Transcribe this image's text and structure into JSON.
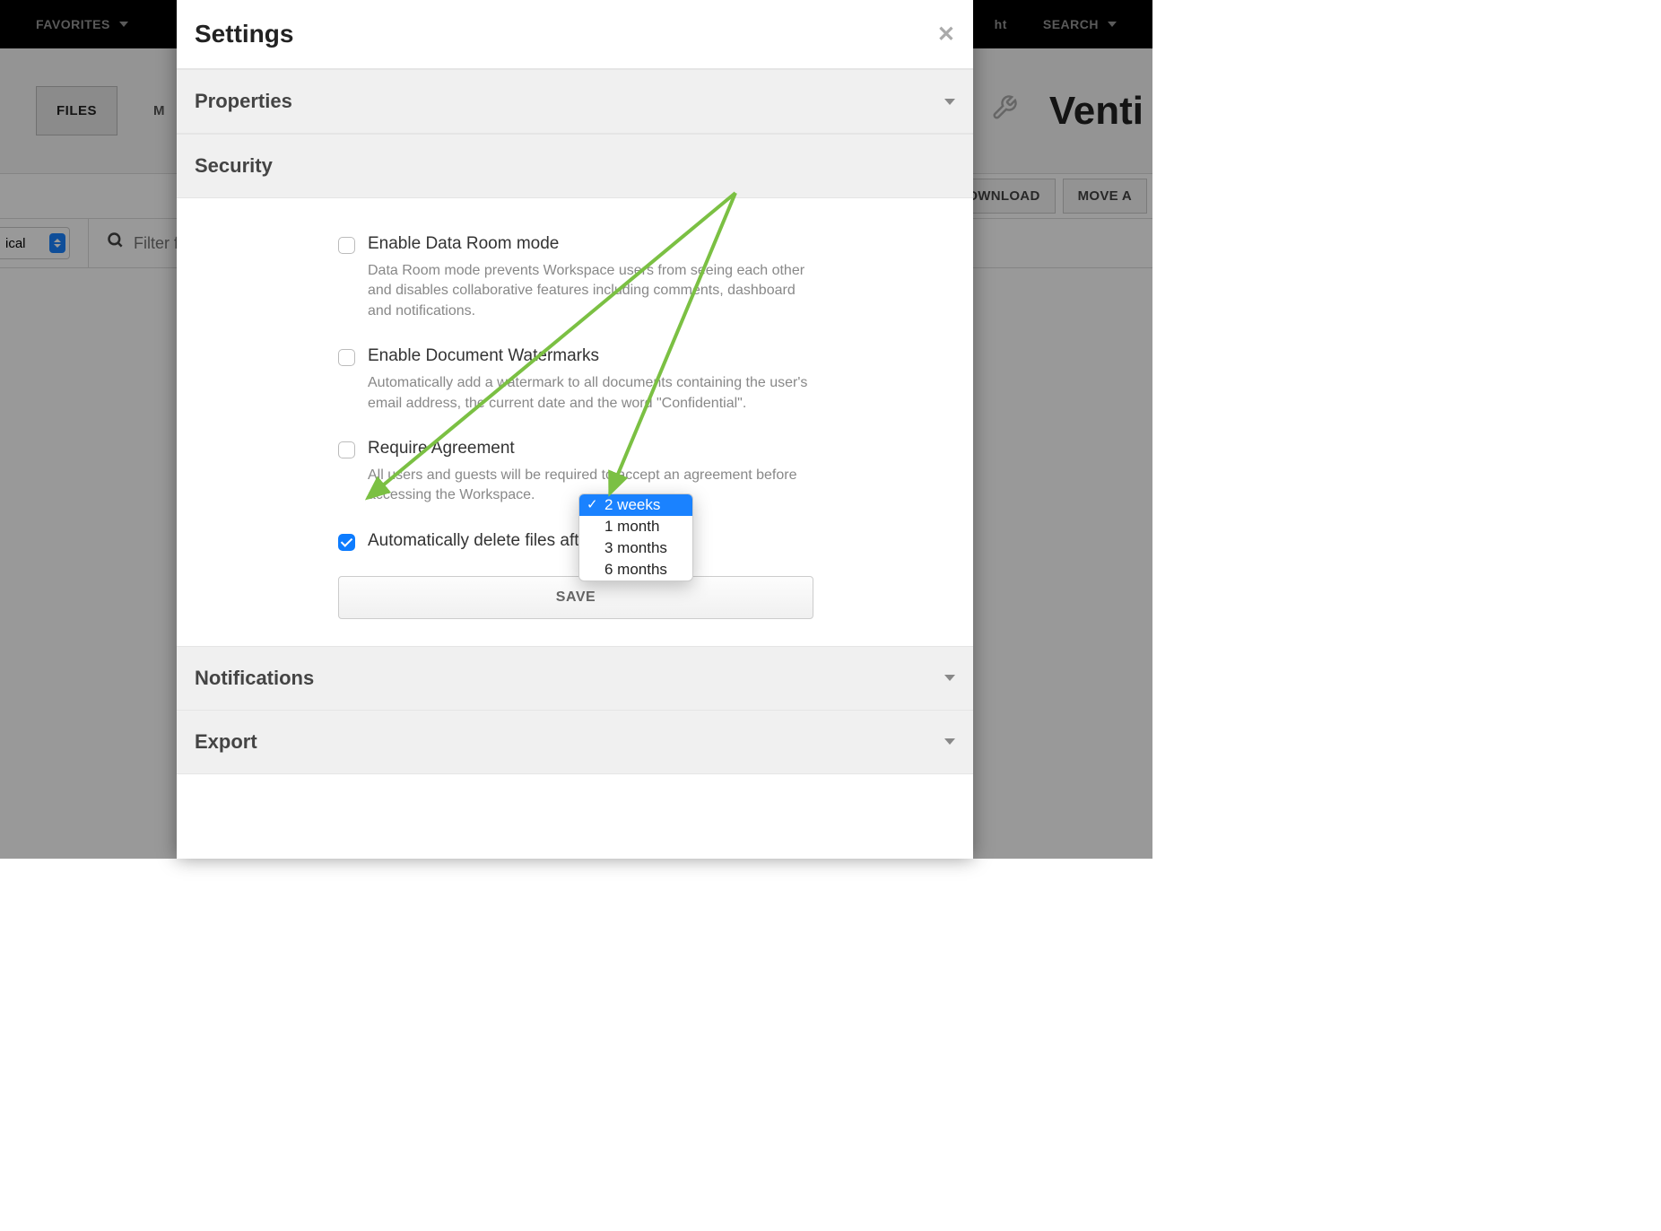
{
  "nav": {
    "favorites": "FAVORITES",
    "right_partial": "ht",
    "search": "SEARCH"
  },
  "secondary": {
    "files_tab": "FILES",
    "tab_partial": "M",
    "brand": "Venti"
  },
  "toolbar": {
    "download": "DOWNLOAD",
    "move": "MOVE A"
  },
  "filter": {
    "select_partial": "ical",
    "placeholder": "Filter f"
  },
  "modal": {
    "title": "Settings",
    "sections": {
      "properties": "Properties",
      "security": "Security",
      "notifications": "Notifications",
      "export": "Export"
    },
    "security": {
      "opt1": {
        "label": "Enable Data Room mode",
        "desc": "Data Room mode prevents Workspace users from seeing each other and disables collaborative features including comments, dashboard and notifications."
      },
      "opt2": {
        "label": "Enable Document Watermarks",
        "desc": "Automatically add a watermark to all documents containing the user's email address, the current date and the word \"Confidential\"."
      },
      "opt3": {
        "label": "Require Agreement",
        "desc": "All users and guests will be required to accept an agreement before accessing the Workspace."
      },
      "opt4": {
        "label": "Automatically delete files after"
      },
      "save": "SAVE"
    }
  },
  "dropdown": {
    "options": [
      "2 weeks",
      "1 month",
      "3 months",
      "6 months"
    ],
    "selected": "2 weeks"
  }
}
